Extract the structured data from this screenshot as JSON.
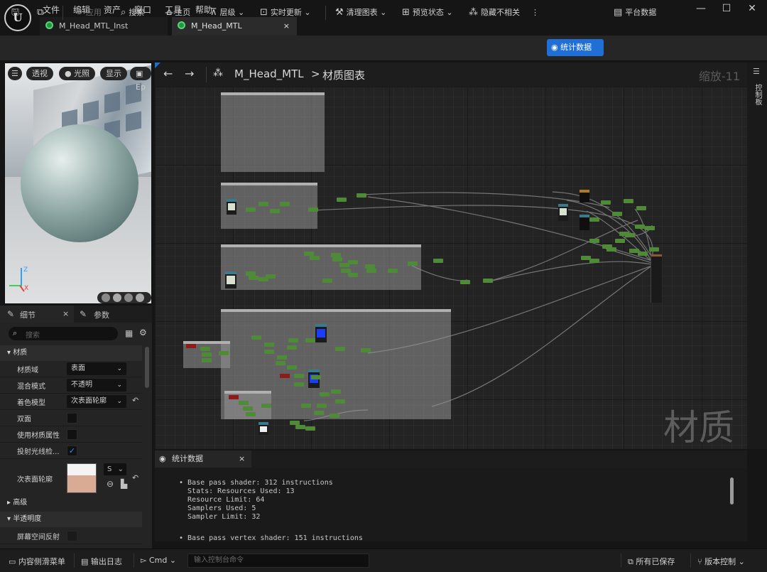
{
  "app": {
    "logo": "U"
  },
  "menu": [
    "文件",
    "编辑",
    "资产",
    "窗口",
    "工具",
    "帮助"
  ],
  "tabs": [
    {
      "label": "M_Head_MTL_Inst",
      "active": false
    },
    {
      "label": "M_Head_MTL",
      "active": true
    }
  ],
  "tab_close": "×",
  "toolbar": {
    "apply": "应用",
    "search": "搜索",
    "home": "主页",
    "hierarchy": "层级",
    "live_update": "实时更新",
    "clean_graph": "清理图表",
    "preview_state": "预览状态",
    "hide_unrelated": "隐藏不相关",
    "stats": "统计数据",
    "platform_stats": "平台数据"
  },
  "viewport": {
    "perspective": "透视",
    "lit": "光照",
    "show": "显示",
    "extra": "Ep",
    "axis_z": "Z",
    "axis_x": "X"
  },
  "details_tabs": {
    "details": "细节",
    "params": "参数",
    "close": "×"
  },
  "details": {
    "search_placeholder": "搜索",
    "section_material": "材质",
    "rows": [
      {
        "label": "材质域",
        "value": "表面"
      },
      {
        "label": "混合模式",
        "value": "不透明"
      },
      {
        "label": "着色模型",
        "value": "次表面轮廓"
      },
      {
        "label": "双面",
        "checked": false
      },
      {
        "label": "使用材质属性",
        "checked": false
      },
      {
        "label": "投射光线检...",
        "checked": true
      }
    ],
    "subsurface_label": "次表面轮廓",
    "subsurface_select": "S",
    "section_advanced": "高级",
    "section_translucency": "半透明度",
    "screen_space_label": "屏幕空间反射"
  },
  "graph": {
    "breadcrumb_asset": "M_Head_MTL",
    "breadcrumb_sep": ">",
    "breadcrumb_graph": "材质图表",
    "zoom": "缩放-11",
    "watermark": "材质",
    "side_tab": "控制板"
  },
  "stats_panel": {
    "tab": "统计数据",
    "close": "×",
    "lines": [
      "• Base pass shader: 312 instructions",
      "  Stats: Resources Used: 13",
      "  Resource Limit: 64",
      "  Samplers Used: 5",
      "  Sampler Limit: 32",
      "",
      "• Base pass vertex shader: 151 instructions"
    ]
  },
  "bottom": {
    "content_drawer": "内容侧滑菜单",
    "output_log": "输出日志",
    "cmd": "Cmd",
    "cmd_placeholder": "输入控制台命令",
    "all_saved": "所有已保存",
    "version_control": "版本控制"
  },
  "colors": {
    "accent": "#1f6fd6",
    "node_green": "#4e8a38",
    "tab_icon": "#1d9a3a"
  }
}
